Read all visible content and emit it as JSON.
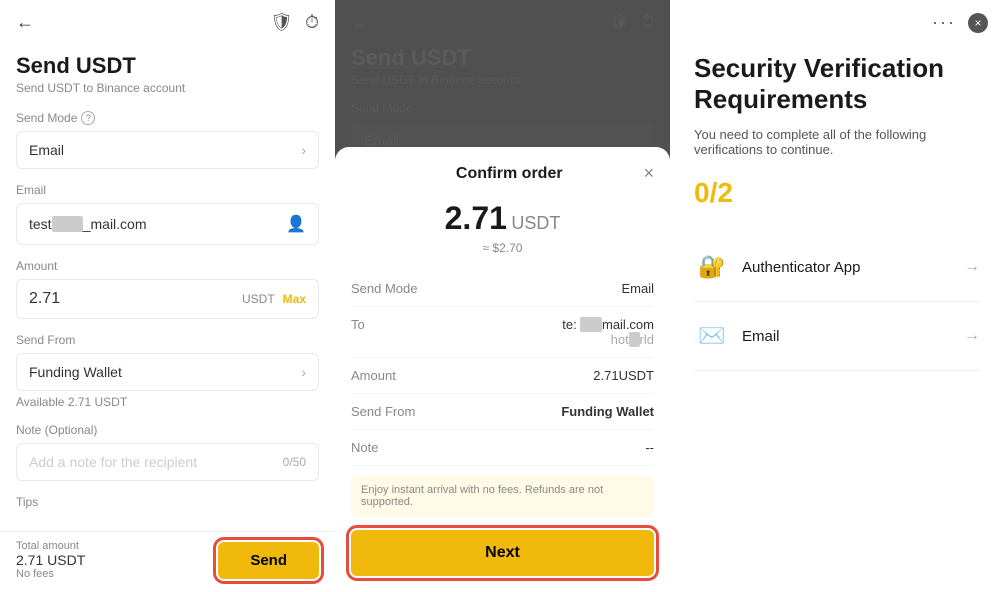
{
  "left_panel": {
    "title": "Send USDT",
    "subtitle": "Send USDT to Binance account",
    "send_mode_label": "Send Mode",
    "send_mode_value": "Email",
    "email_label": "Email",
    "email_value": "test        _mail.com",
    "amount_label": "Amount",
    "amount_value": "2.71",
    "usdt_label": "USDT",
    "max_label": "Max",
    "send_from_label": "Send From",
    "send_from_value": "Funding Wallet",
    "available_text": "Available 2.71 USDT",
    "note_label": "Note (Optional)",
    "note_placeholder": "Add a note for the recipient",
    "note_count": "0/50",
    "tips_label": "Tips",
    "total_amount_label": "Total amount",
    "total_amount_value": "2.71 USDT",
    "total_fees": "No fees",
    "send_button": "Send"
  },
  "confirm_modal": {
    "title": "Confirm order",
    "amount": "2.71",
    "currency": "USDT",
    "approx": "≈ $2.70",
    "send_mode_label": "Send Mode",
    "send_mode_value": "Email",
    "to_label": "To",
    "to_value_line1": "te:           mail.com",
    "to_value_line2": "hot      rld",
    "amount_label": "Amount",
    "amount_value": "2.71USDT",
    "send_from_label": "Send From",
    "send_from_value": "Funding Wallet",
    "note_label": "Note",
    "note_value": "--",
    "notice_text": "Enjoy instant arrival with no fees. Refunds are not supported.",
    "next_button": "Next"
  },
  "right_panel": {
    "title": "Security Verification Requirements",
    "description": "You need to complete all of the following verifications to continue.",
    "progress": "0/2",
    "items": [
      {
        "label": "Authenticator App",
        "icon": "🔐"
      },
      {
        "label": "Email",
        "icon": "✉️"
      }
    ],
    "three_dots": "···",
    "close_label": "×"
  }
}
